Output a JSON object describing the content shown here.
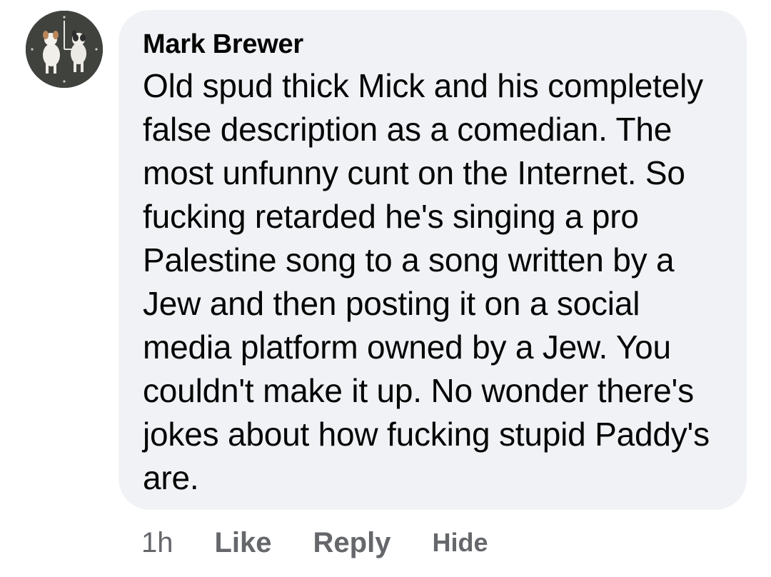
{
  "comment": {
    "author": "Mark Brewer",
    "text": "Old spud thick Mick and his completely false description as a comedian. The most unfunny cunt on the Internet. So fucking retarded he's singing a pro Palestine song to a song written by a Jew and then posting it on a social media platform owned by a Jew. You couldn't make it up. No wonder there's jokes about how fucking stupid Paddy's are.",
    "time": "1h",
    "like_label": "Like",
    "reply_label": "Reply",
    "hide_label": "Hide"
  },
  "colors": {
    "bubble_bg": "#f0f2f5",
    "text": "#050505",
    "secondary_text": "#65676b"
  },
  "icons": {
    "avatar": "profile-avatar-dogs-clock"
  }
}
